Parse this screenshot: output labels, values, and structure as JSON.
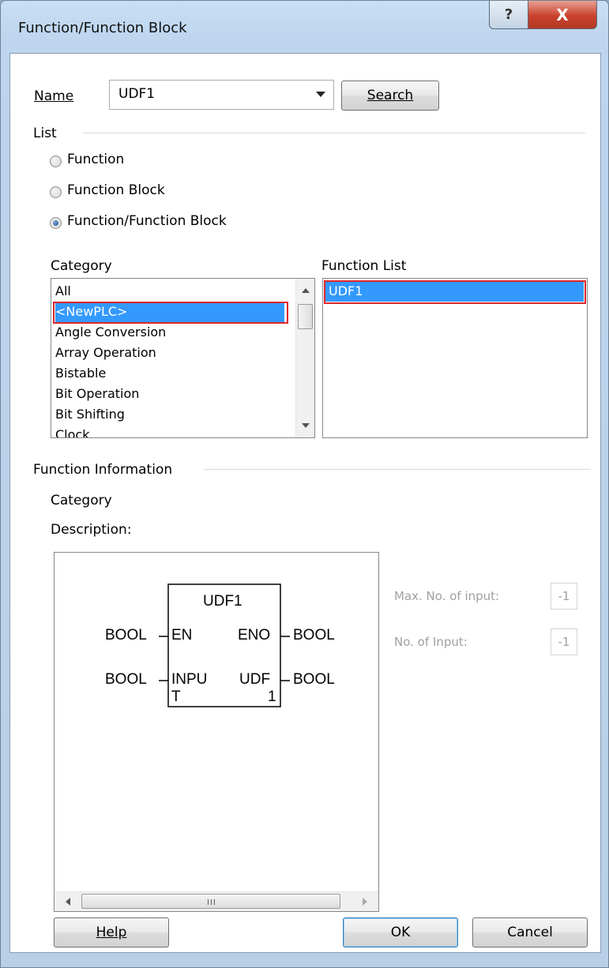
{
  "window": {
    "title": "Function/Function Block",
    "help_glyph": "?",
    "close_glyph": "X"
  },
  "name_field": {
    "label": "Name",
    "value": "UDF1"
  },
  "search_button": "Search",
  "list_group": {
    "label": "List",
    "options": [
      "Function",
      "Function Block",
      "Function/Function Block"
    ],
    "selected": "Function/Function Block"
  },
  "category": {
    "label": "Category",
    "items": [
      "All",
      "<NewPLC>",
      "Angle Conversion",
      "Array Operation",
      "Bistable",
      "Bit Operation",
      "Bit Shifting",
      "Clock"
    ],
    "selected": "<NewPLC>"
  },
  "function_list": {
    "label": "Function List",
    "items": [
      "UDF1"
    ],
    "selected": "UDF1"
  },
  "function_info": {
    "label": "Function Information",
    "category_label": "Category",
    "description_label": "Description:"
  },
  "block": {
    "name": "UDF1",
    "input_en_type": "BOOL",
    "input_en_name": "EN",
    "input2_type": "BOOL",
    "input2_name_line1": "INPU",
    "input2_name_line2": "T",
    "output_eno_name": "ENO",
    "output_eno_type": "BOOL",
    "output2_name_line1": "UDF",
    "output2_name_line2": "1",
    "output2_type": "BOOL"
  },
  "max_inputs": {
    "label": "Max. No. of input:",
    "value": "-1"
  },
  "num_inputs": {
    "label": "No. of Input:",
    "value": "-1"
  },
  "scroll_grip": "III",
  "buttons": {
    "help": "Help",
    "ok": "OK",
    "cancel": "Cancel"
  },
  "colors": {
    "selection": "#3399ff",
    "highlight_border": "#e0262b",
    "frame": "#b8cfe7"
  }
}
